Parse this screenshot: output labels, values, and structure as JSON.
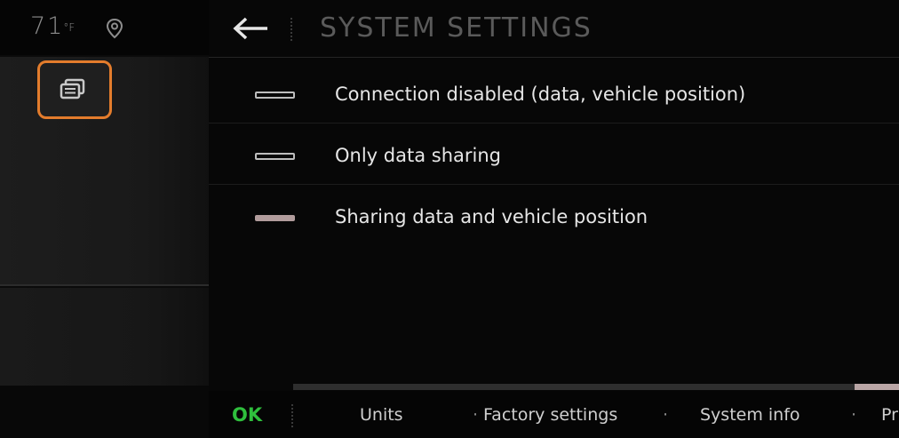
{
  "status_bar": {
    "temperature": "71",
    "temperature_unit": "°F",
    "location_icon": "location-pin-icon"
  },
  "sidebar": {
    "active_button_icon": "stacked-windows-icon"
  },
  "header": {
    "back_icon": "back-arrow-icon",
    "title": "SYSTEM SETTINGS"
  },
  "options": [
    {
      "label": "Connection disabled (data, vehicle position)",
      "selected": false
    },
    {
      "label": "Only data sharing",
      "selected": false
    },
    {
      "label": "Sharing data and vehicle position",
      "selected": true
    }
  ],
  "bottom_bar": {
    "ok_label": "OK",
    "items": [
      "Units",
      "Factory settings",
      "System info",
      "Pr"
    ],
    "separator": "·"
  },
  "colors": {
    "accent_orange": "#e37c2c",
    "ok_green": "#2fbf3d",
    "selected_indicator": "#b19c9c"
  }
}
